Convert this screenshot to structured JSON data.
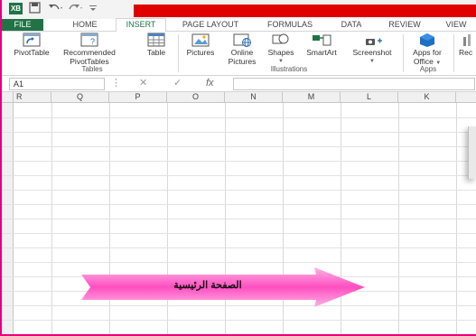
{
  "colors": {
    "excel_green": "#217346",
    "red_banner": "#e00000",
    "callout_pink": "#ff4fc0",
    "frame_magenta": "#e2007a"
  },
  "titlebar": {
    "app_icon_text": "XB",
    "save_icon": "save-icon",
    "undo_icon": "undo-icon",
    "redo_icon": "redo-icon"
  },
  "tabs": [
    {
      "label": "FILE"
    },
    {
      "label": "HOME"
    },
    {
      "label": "INSERT"
    },
    {
      "label": "PAGE LAYOUT"
    },
    {
      "label": "FORMULAS"
    },
    {
      "label": "DATA"
    },
    {
      "label": "REVIEW"
    },
    {
      "label": "VIEW"
    }
  ],
  "ribbon": {
    "tables": {
      "pivottable": "PivotTable",
      "recommended_line1": "Recommended",
      "recommended_line2": "PivotTables",
      "table": "Table",
      "group": "Tables"
    },
    "illustrations": {
      "pictures": "Pictures",
      "online_line1": "Online",
      "online_line2": "Pictures",
      "shapes": "Shapes",
      "smartart": "SmartArt",
      "screenshot": "Screenshot",
      "group": "Illustrations"
    },
    "apps": {
      "line1": "Apps for",
      "line2": "Office",
      "group": "Apps"
    },
    "cut_off": "Rec"
  },
  "formula_bar": {
    "name_box": "A1",
    "fx": "fx",
    "formula": ""
  },
  "columns": [
    "R",
    "Q",
    "P",
    "O",
    "N",
    "M",
    "L",
    "K"
  ],
  "callout": {
    "text": "الصفحة الرئيسية"
  }
}
